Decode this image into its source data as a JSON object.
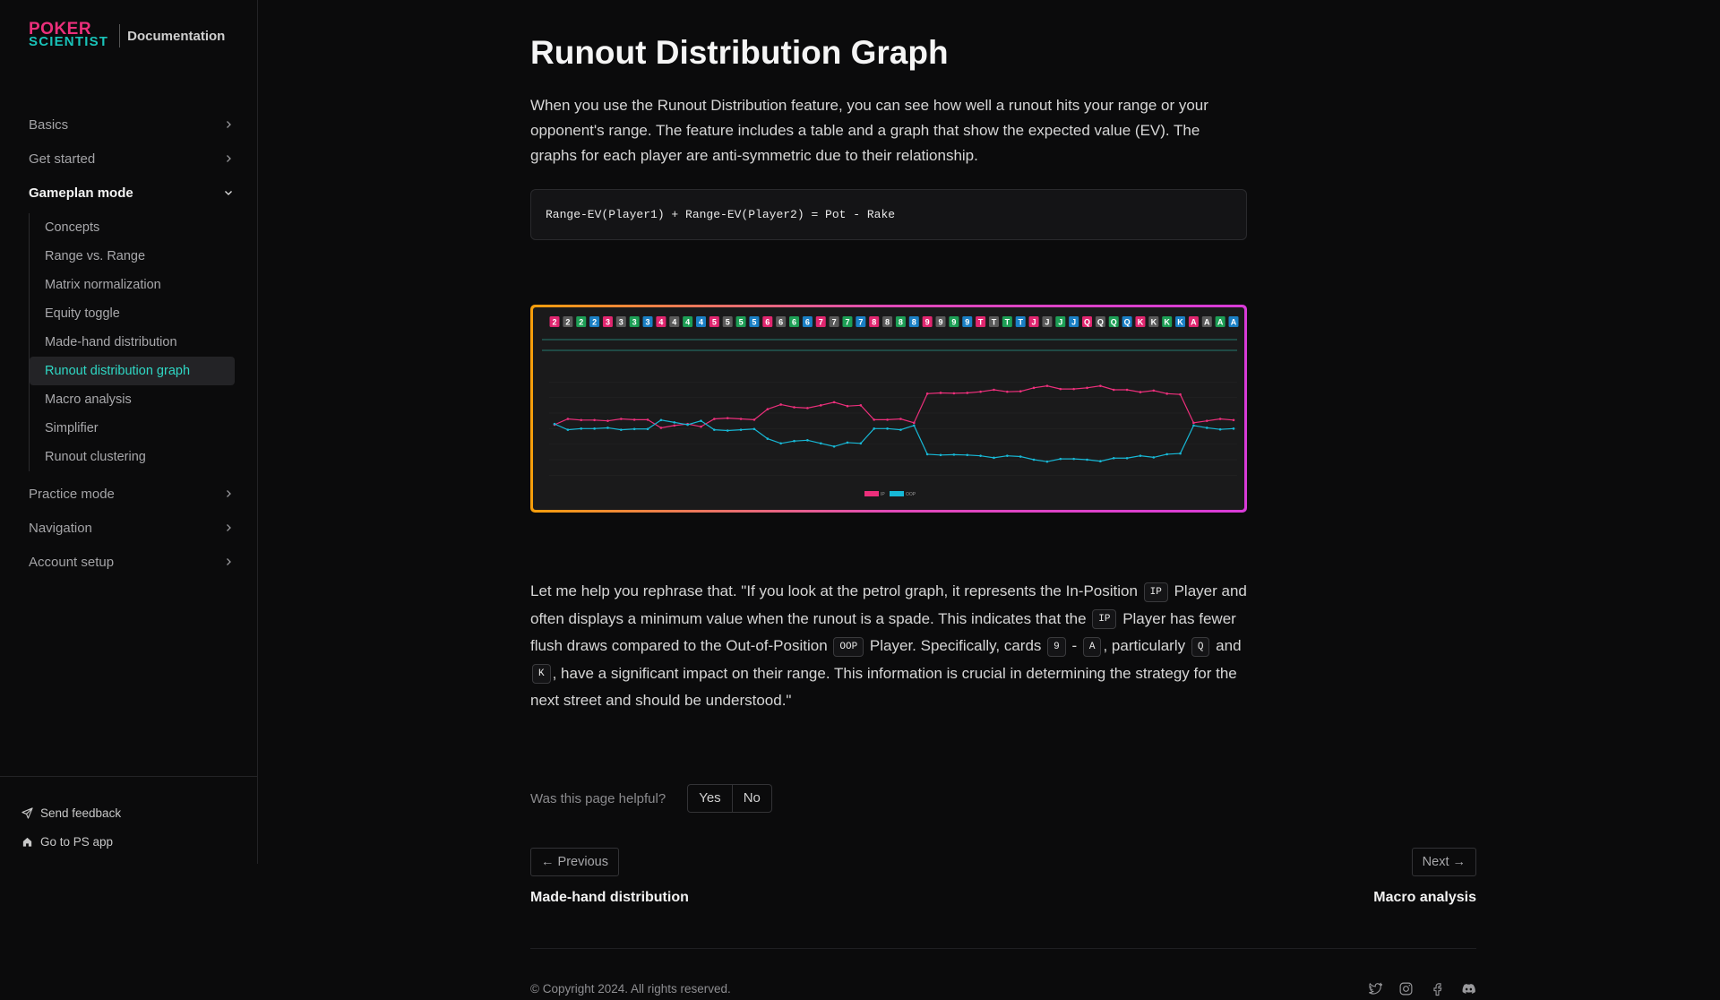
{
  "brand": {
    "logo_line1": "POKER",
    "logo_line2": "SCIENTIST",
    "section": "Documentation"
  },
  "sidebar": {
    "items": [
      {
        "label": "Basics"
      },
      {
        "label": "Get started"
      },
      {
        "label": "Gameplan mode"
      },
      {
        "label": "Practice mode"
      },
      {
        "label": "Navigation"
      },
      {
        "label": "Account setup"
      }
    ],
    "sub_items": [
      {
        "label": "Concepts"
      },
      {
        "label": "Range vs. Range"
      },
      {
        "label": "Matrix normalization"
      },
      {
        "label": "Equity toggle"
      },
      {
        "label": "Made-hand distribution"
      },
      {
        "label": "Runout distribution graph"
      },
      {
        "label": "Macro analysis"
      },
      {
        "label": "Simplifier"
      },
      {
        "label": "Runout clustering"
      }
    ],
    "footer": {
      "feedback": "Send feedback",
      "app": "Go to PS app"
    }
  },
  "page": {
    "title": "Runout Distribution Graph",
    "intro": "When you use the Runout Distribution feature, you can see how well a runout hits your range or your opponent's range. The feature includes a table and a graph that show the expected value (EV). The graphs for each player are anti-symmetric due to their relationship.",
    "code": "Range-EV(Player1) + Range-EV(Player2) = Pot - Rake",
    "body": {
      "t1": "Let me help you rephrase that. \"If you look at the petrol graph, it represents the In-Position ",
      "k1": "IP",
      "t2": " Player and often displays a minimum value when the runout is a spade. This indicates that the ",
      "k2": "IP",
      "t3": " Player has fewer flush draws compared to the Out-of-Position ",
      "k3": "OOP",
      "t4": " Player. Specifically, cards ",
      "k4": "9",
      "t5": " - ",
      "k5": "A",
      "t6": ", particularly ",
      "k6": "Q",
      "t7": " and ",
      "k7": "K",
      "t8": ", have a significant impact on their range. This information is crucial in determining the strategy for the next street and should be understood.\""
    },
    "helpful": {
      "question": "Was this page helpful?",
      "yes": "Yes",
      "no": "No"
    },
    "pager": {
      "prev_label": "← Previous",
      "prev_title": "Made-hand distribution",
      "next_label": "Next →",
      "next_title": "Macro analysis"
    },
    "copyright": "© Copyright 2024. All rights reserved."
  },
  "colors": {
    "ip": "#ec2f7b",
    "oop": "#17b8d6",
    "accent": "#2fd7c4"
  },
  "chart_data": {
    "type": "line",
    "cards": [
      "2",
      "2",
      "2",
      "2",
      "3",
      "3",
      "3",
      "3",
      "4",
      "4",
      "4",
      "4",
      "5",
      "5",
      "5",
      "5",
      "6",
      "6",
      "6",
      "6",
      "7",
      "7",
      "7",
      "7",
      "8",
      "8",
      "8",
      "8",
      "9",
      "9",
      "9",
      "9",
      "T",
      "T",
      "T",
      "T",
      "J",
      "J",
      "J",
      "J",
      "Q",
      "Q",
      "Q",
      "Q",
      "K",
      "K",
      "K",
      "K",
      "A",
      "A",
      "A",
      "A"
    ],
    "suits": [
      "h",
      "c",
      "d",
      "s",
      "h",
      "c",
      "d",
      "s",
      "h",
      "c",
      "d",
      "s",
      "h",
      "c",
      "d",
      "s",
      "h",
      "c",
      "d",
      "s",
      "h",
      "c",
      "d",
      "s",
      "h",
      "c",
      "d",
      "s",
      "h",
      "c",
      "d",
      "s",
      "h",
      "c",
      "d",
      "s",
      "h",
      "c",
      "d",
      "s",
      "h",
      "c",
      "d",
      "s",
      "h",
      "c",
      "d",
      "s",
      "h",
      "c",
      "d",
      "s"
    ],
    "suit_colors": {
      "h": "#e0266f",
      "c": "#5a5a5a",
      "d": "#1d9e55",
      "s": "#1a7fc4"
    },
    "ylim": [
      1.8,
      4.8
    ],
    "series": [
      {
        "name": "IP",
        "values": [
          3.3,
          3.45,
          3.42,
          3.42,
          3.4,
          3.45,
          3.43,
          3.43,
          3.22,
          3.28,
          3.32,
          3.25,
          3.45,
          3.47,
          3.45,
          3.43,
          3.7,
          3.82,
          3.75,
          3.73,
          3.8,
          3.88,
          3.78,
          3.8,
          3.43,
          3.43,
          3.45,
          3.35,
          4.1,
          4.12,
          4.11,
          4.12,
          4.15,
          4.2,
          4.15,
          4.16,
          4.25,
          4.3,
          4.22,
          4.22,
          4.25,
          4.3,
          4.2,
          4.2,
          4.14,
          4.18,
          4.1,
          4.08,
          3.35,
          3.4,
          3.45,
          3.42
        ]
      },
      {
        "name": "OOP",
        "values": [
          3.32,
          3.17,
          3.2,
          3.2,
          3.22,
          3.17,
          3.19,
          3.19,
          3.42,
          3.36,
          3.3,
          3.4,
          3.17,
          3.15,
          3.17,
          3.19,
          2.94,
          2.82,
          2.88,
          2.9,
          2.82,
          2.74,
          2.84,
          2.82,
          3.2,
          3.2,
          3.17,
          3.28,
          2.54,
          2.52,
          2.53,
          2.52,
          2.5,
          2.45,
          2.5,
          2.48,
          2.4,
          2.35,
          2.42,
          2.42,
          2.4,
          2.36,
          2.44,
          2.44,
          2.5,
          2.46,
          2.54,
          2.56,
          3.28,
          3.22,
          3.18,
          3.2
        ]
      }
    ]
  }
}
